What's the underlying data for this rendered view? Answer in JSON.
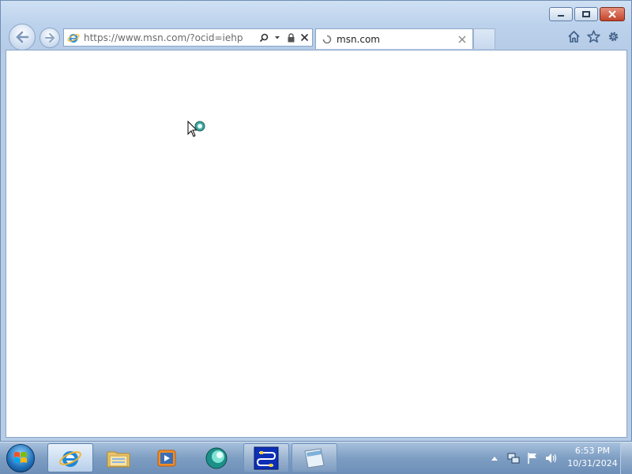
{
  "browser": {
    "address": {
      "url": "https://www.msn.com/?ocid=iehp",
      "site_icon": "ie-icon",
      "search_icon": "search-icon",
      "dropdown_icon": "chevron-down-icon",
      "lock_icon": "lock-icon",
      "stop_icon": "close-icon"
    },
    "tab": {
      "title": "msn.com",
      "loading_icon": "spinner-icon",
      "close_icon": "close-icon"
    },
    "command_icons": [
      "home-icon",
      "star-icon",
      "gear-icon"
    ],
    "window_buttons": [
      "minimize-icon",
      "restore-icon",
      "close-icon"
    ],
    "nav": [
      "back-arrow-icon",
      "forward-arrow-icon"
    ]
  },
  "taskbar": {
    "start_icon": "windows-logo-icon",
    "apps": [
      {
        "name": "internet-explorer",
        "icon": "ie-icon",
        "state": "active"
      },
      {
        "name": "windows-explorer",
        "icon": "folder-icon",
        "state": "normal"
      },
      {
        "name": "media-player",
        "icon": "media-player-icon",
        "state": "normal"
      },
      {
        "name": "app-green",
        "icon": "green-app-icon",
        "state": "normal"
      },
      {
        "name": "app-blue",
        "icon": "blue-app-icon",
        "state": "pinned"
      },
      {
        "name": "app-notepad",
        "icon": "notepad-icon",
        "state": "pinned"
      }
    ],
    "tray_icons": [
      "tray-arrow-icon",
      "network-icon",
      "flag-icon",
      "volume-icon"
    ],
    "clock": {
      "time": "6:53 PM",
      "date": "10/31/2024"
    }
  },
  "colors": {
    "accent": "#1f6fb8",
    "close_button": "#c3442b",
    "frame": "#bcd2ec"
  }
}
